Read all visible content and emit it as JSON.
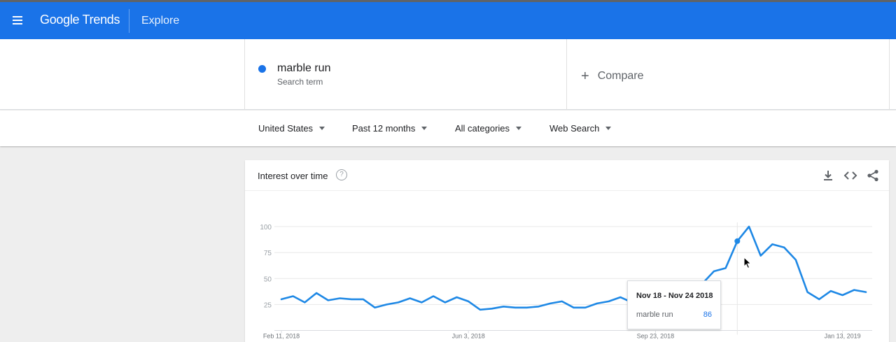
{
  "header": {
    "logo_google": "Google",
    "logo_trends": "Trends",
    "section": "Explore"
  },
  "search": {
    "term": "marble run",
    "term_type": "Search term",
    "term_color": "#1a73e8",
    "compare_label": "Compare"
  },
  "filters": {
    "region": "United States",
    "period": "Past 12 months",
    "category": "All categories",
    "property": "Web Search"
  },
  "card": {
    "title": "Interest over time",
    "help_glyph": "?",
    "tools": [
      "download-icon",
      "embed-icon",
      "share-icon"
    ]
  },
  "tooltip": {
    "date_range": "Nov 18 - Nov 24 2018",
    "term": "marble run",
    "value": "86"
  },
  "chart_data": {
    "type": "line",
    "ylim": [
      0,
      100
    ],
    "y_ticks": [
      "25",
      "50",
      "75",
      "100"
    ],
    "x_ticks": [
      {
        "label": "Feb 11, 2018",
        "index": 0
      },
      {
        "label": "Jun 3, 2018",
        "index": 16
      },
      {
        "label": "Sep 23, 2018",
        "index": 32
      },
      {
        "label": "Jan 13, 2019",
        "index": 48
      }
    ],
    "series": [
      {
        "color": "#1e88e5",
        "values": [
          30,
          33,
          27,
          36,
          29,
          31,
          30,
          30,
          22,
          25,
          27,
          31,
          27,
          33,
          27,
          32,
          28,
          20,
          21,
          23,
          22,
          22,
          23,
          26,
          28,
          22,
          22,
          26,
          28,
          32,
          27,
          33,
          29,
          26,
          30,
          38,
          45,
          57,
          60,
          86,
          100,
          72,
          83,
          80,
          68,
          37,
          30,
          38,
          34,
          39,
          37
        ]
      }
    ],
    "highlight_index": 39
  }
}
